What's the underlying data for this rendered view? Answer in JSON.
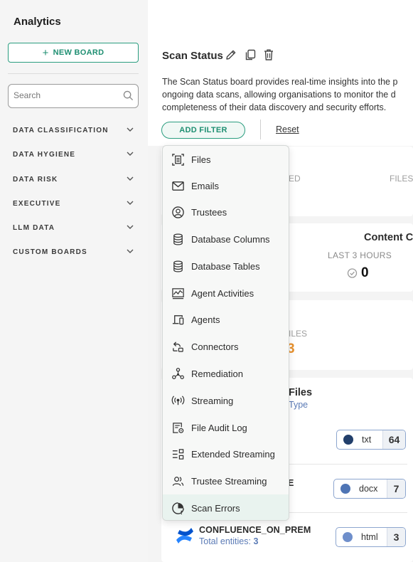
{
  "sidebar": {
    "title": "Analytics",
    "new_board_label": "NEW BOARD",
    "search_placeholder": "Search",
    "categories": [
      {
        "label": "DATA CLASSIFICATION"
      },
      {
        "label": "DATA HYGIENE"
      },
      {
        "label": "DATA RISK"
      },
      {
        "label": "EXECUTIVE"
      },
      {
        "label": "LLM DATA"
      },
      {
        "label": "CUSTOM BOARDS"
      }
    ]
  },
  "board": {
    "title": "Scan Status",
    "description_lines": [
      "The Scan Status board provides real-time insights into the p",
      "ongoing data scans, allowing organisations to monitor the d",
      "completeness of their data discovery and security efforts."
    ],
    "add_filter_label": "ADD FILTER",
    "reset_label": "Reset"
  },
  "cards": {
    "ghost_ed": "ED",
    "ghost_files": "FILES",
    "content_title": "Content C",
    "last3_label": "LAST 3 HOURS",
    "last3_value": "0",
    "ghost_iles": "ILES",
    "orange_value": "3",
    "files_title": "Files",
    "files_subtitle": "Type",
    "ghost_e": "E"
  },
  "file_types": [
    {
      "ext": "txt",
      "count": "64",
      "color": "#223f6b"
    },
    {
      "ext": "docx",
      "count": "7",
      "color": "#4f75b5"
    },
    {
      "ext": "html",
      "count": "3",
      "color": "#6f8fcb"
    }
  ],
  "connector": {
    "name": "CONFLUENCE_ON_PREM",
    "entities_label": "Total entities:",
    "entities_value": "3"
  },
  "filter_menu": {
    "items": [
      {
        "label": "Files",
        "icon": "file-text-icon"
      },
      {
        "label": "Emails",
        "icon": "mail-icon"
      },
      {
        "label": "Trustees",
        "icon": "user-circle-icon"
      },
      {
        "label": "Database Columns",
        "icon": "database-icon"
      },
      {
        "label": "Database Tables",
        "icon": "database-icon"
      },
      {
        "label": "Agent Activities",
        "icon": "activity-chart-icon"
      },
      {
        "label": "Agents",
        "icon": "devices-icon"
      },
      {
        "label": "Connectors",
        "icon": "connector-icon"
      },
      {
        "label": "Remediation",
        "icon": "network-nodes-icon"
      },
      {
        "label": "Streaming",
        "icon": "broadcast-icon"
      },
      {
        "label": "File Audit Log",
        "icon": "audit-log-icon"
      },
      {
        "label": "Extended Streaming",
        "icon": "extended-stream-icon"
      },
      {
        "label": "Trustee Streaming",
        "icon": "users-icon"
      },
      {
        "label": "Scan Errors",
        "icon": "scan-error-icon"
      }
    ],
    "active_item": "Scan Errors"
  },
  "colors": {
    "accent": "#1f8f72",
    "orange": "#e8912d",
    "link_blue": "#5b7bb6"
  }
}
